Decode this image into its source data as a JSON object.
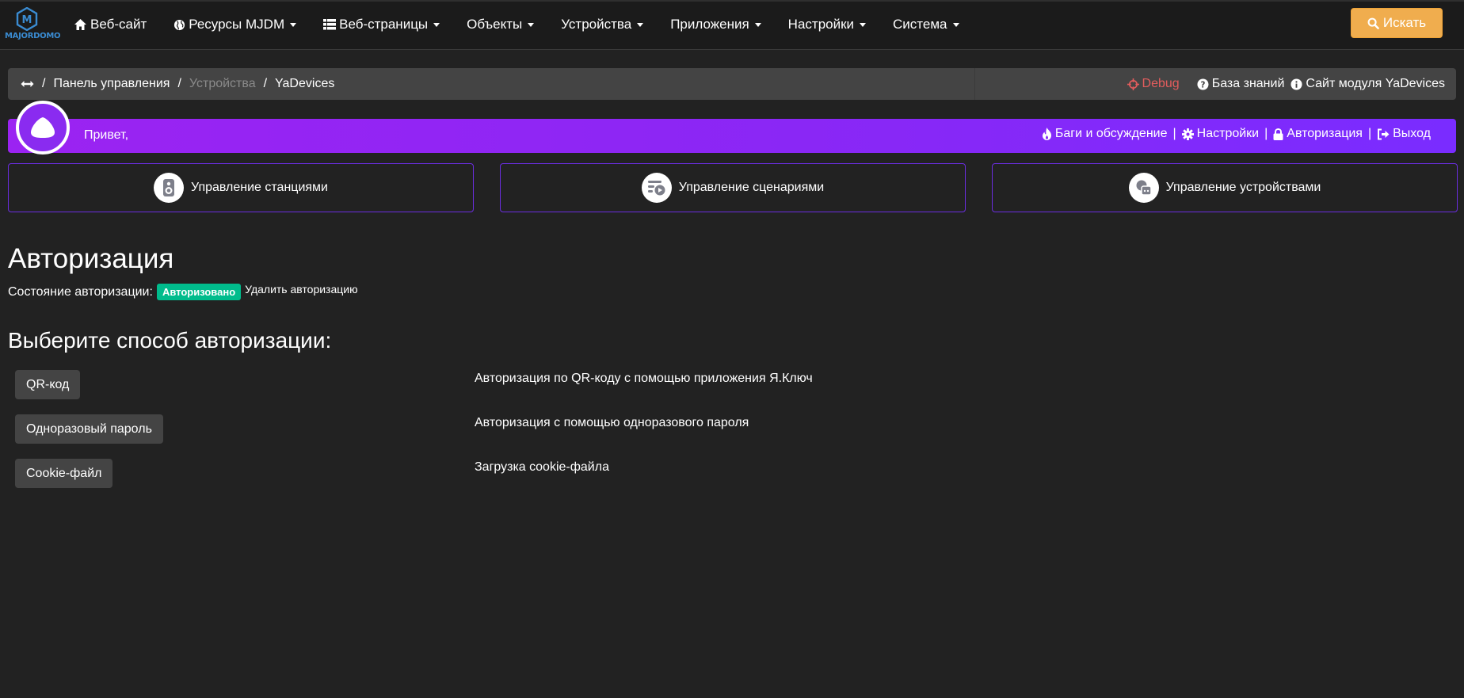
{
  "brand": {
    "logo_text": "MAJORDOMO"
  },
  "nav": {
    "items": [
      {
        "label": "Веб-сайт",
        "icon": "home-icon",
        "dropdown": false
      },
      {
        "label": "Ресурсы MJDM",
        "icon": "globe-icon",
        "dropdown": true
      },
      {
        "label": "Веб-страницы",
        "icon": "table-icon",
        "dropdown": true
      },
      {
        "label": "Объекты",
        "dropdown": true
      },
      {
        "label": "Устройства",
        "dropdown": true
      },
      {
        "label": "Приложения",
        "dropdown": true
      },
      {
        "label": "Настройки",
        "dropdown": true
      },
      {
        "label": "Система",
        "dropdown": true
      }
    ],
    "search_label": "Искать"
  },
  "breadcrumb": {
    "items": [
      "Панель управления",
      "Устройства",
      "YaDevices"
    ],
    "debug": "Debug",
    "knowledge": "База знаний",
    "module_site": "Сайт модуля YaDevices"
  },
  "alice": {
    "greeting": "Привет,",
    "links": {
      "bugs": "Баги и обсуждение",
      "settings": "Настройки",
      "auth": "Авторизация",
      "logout": "Выход"
    }
  },
  "management": {
    "stations": "Управление станциями",
    "scenarios": "Управление сценариями",
    "devices": "Управление устройствами"
  },
  "auth": {
    "title": "Авторизация",
    "status_label": "Состояние авторизации:",
    "status_value": "Авторизовано",
    "delete_label": "Удалить авторизацию",
    "choose_title": "Выберите способ авторизации:",
    "methods": [
      {
        "label": "QR-код",
        "desc": "Авторизация по QR-коду с помощью приложения Я.Ключ"
      },
      {
        "label": "Одноразовый пароль",
        "desc": "Авторизация с помощью одноразового пароля"
      },
      {
        "label": "Cookie-файл",
        "desc": "Загрузка cookie-файла"
      }
    ]
  },
  "colors": {
    "background": "#222222",
    "navbar": "#1b1b1b",
    "search_button": "#f0ad4e",
    "alice_gradient_start": "#9b23f2",
    "alice_gradient_end": "#7a2cff",
    "badge_success": "#00bc8c",
    "debug": "#e35d5d",
    "card_border": "#6b2de0"
  }
}
